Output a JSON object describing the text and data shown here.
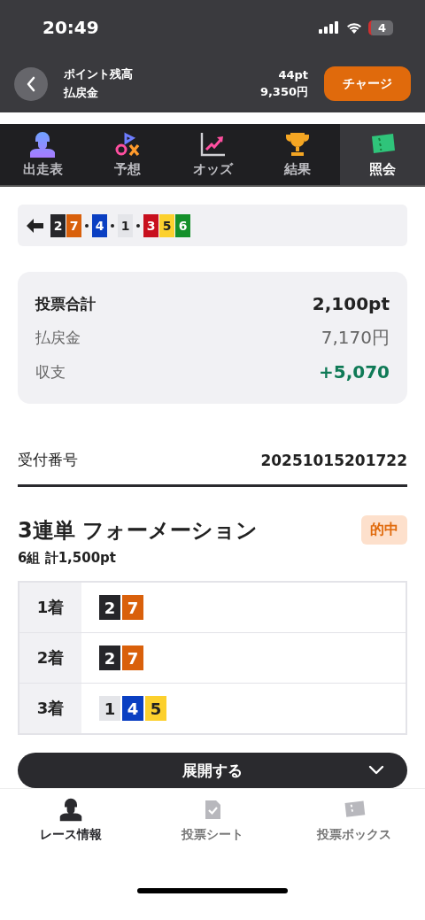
{
  "status_bar": {
    "time": "20:49",
    "battery": "4"
  },
  "header": {
    "balance_label": "ポイント残高",
    "balance_value": "44pt",
    "refund_label": "払戻金",
    "refund_value": "9,350円",
    "charge_button": "チャージ"
  },
  "tabs": [
    {
      "label": "出走表",
      "kind": "jockey",
      "selected": false
    },
    {
      "label": "予想",
      "kind": "predict",
      "selected": false
    },
    {
      "label": "オッズ",
      "kind": "chart",
      "selected": false
    },
    {
      "label": "結果",
      "kind": "trophy",
      "selected": false
    },
    {
      "label": "照会",
      "kind": "ticket",
      "selected": true
    }
  ],
  "result": {
    "groups": [
      [
        {
          "number": "2",
          "color": "#26262a"
        },
        {
          "number": "7",
          "color": "#d9600b"
        }
      ],
      [
        {
          "number": "4",
          "color": "#0a3fc2"
        }
      ],
      [
        {
          "number": "1",
          "color": "#e4e5e9"
        }
      ],
      [
        {
          "number": "3",
          "color": "#c8101e"
        },
        {
          "number": "5",
          "color": "#fcd02d"
        },
        {
          "number": "6",
          "color": "#15902a"
        }
      ]
    ]
  },
  "summary": [
    {
      "label": "投票合計",
      "value": "2,100pt",
      "kind": "total"
    },
    {
      "label": "払戻金",
      "value": "7,170円",
      "kind": "plain"
    },
    {
      "label": "収支",
      "value": "+5,070",
      "kind": "profit"
    }
  ],
  "receipt": {
    "label": "受付番号",
    "value": "20251015201722"
  },
  "bet": {
    "title": "3連単 フォーメーション",
    "badge": "的中",
    "subtitle": "6組 計1,500pt",
    "rows": [
      {
        "place": "1着",
        "numbers": [
          {
            "number": "2",
            "color": "#26262a"
          },
          {
            "number": "7",
            "color": "#d9600b"
          }
        ]
      },
      {
        "place": "2着",
        "numbers": [
          {
            "number": "2",
            "color": "#26262a"
          },
          {
            "number": "7",
            "color": "#d9600b"
          }
        ]
      },
      {
        "place": "3着",
        "numbers": [
          {
            "number": "1",
            "color": "#e4e5e9"
          },
          {
            "number": "4",
            "color": "#0a3fc2"
          },
          {
            "number": "5",
            "color": "#fcd02d"
          }
        ]
      }
    ]
  },
  "expand_button": "展開する",
  "bottom_nav": [
    {
      "label": "レース情報",
      "kind": "jockey",
      "selected": true
    },
    {
      "label": "投票シート",
      "kind": "sheet",
      "selected": false
    },
    {
      "label": "投票ボックス",
      "kind": "ticket",
      "selected": false
    }
  ]
}
